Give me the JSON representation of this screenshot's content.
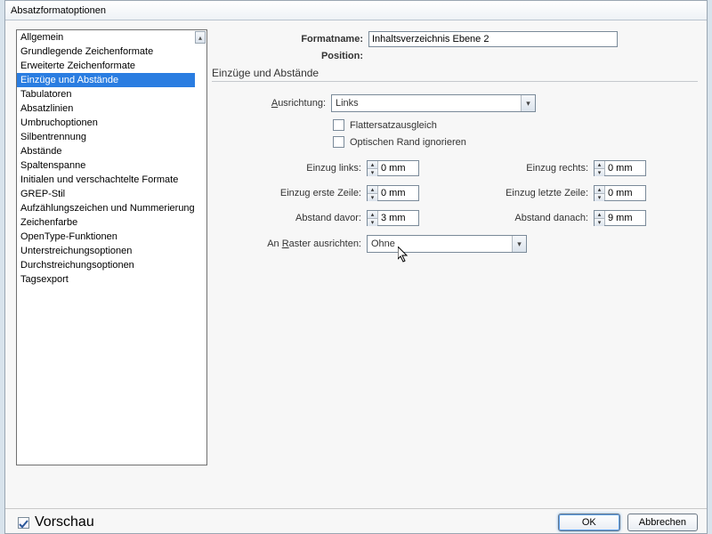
{
  "window": {
    "title": "Absatzformatoptionen"
  },
  "sidebar": {
    "items": [
      {
        "label": "Allgemein"
      },
      {
        "label": "Grundlegende Zeichenformate"
      },
      {
        "label": "Erweiterte Zeichenformate"
      },
      {
        "label": "Einzüge und Abstände"
      },
      {
        "label": "Tabulatoren"
      },
      {
        "label": "Absatzlinien"
      },
      {
        "label": "Umbruchoptionen"
      },
      {
        "label": "Silbentrennung"
      },
      {
        "label": "Abstände"
      },
      {
        "label": "Spaltenspanne"
      },
      {
        "label": "Initialen und verschachtelte Formate"
      },
      {
        "label": "GREP-Stil"
      },
      {
        "label": "Aufzählungszeichen und Nummerierung"
      },
      {
        "label": "Zeichenfarbe"
      },
      {
        "label": "OpenType-Funktionen"
      },
      {
        "label": "Unterstreichungsoptionen"
      },
      {
        "label": "Durchstreichungsoptionen"
      },
      {
        "label": "Tagsexport"
      }
    ],
    "selected_index": 3
  },
  "header": {
    "formatname_label": "Formatname:",
    "formatname_value": "Inhaltsverzeichnis Ebene 2",
    "position_label": "Position:"
  },
  "section": {
    "title": "Einzüge und Abstände"
  },
  "fields": {
    "ausrichtung_label": "usrichtung:",
    "ausrichtung_value": "Links",
    "flattersatz": "Flattersatzausgleich",
    "opt_rand": "Optischen Rand ignorieren",
    "einzug_links_label": "Einzug links:",
    "einzug_links_value": "0 mm",
    "einzug_rechts_label": "Einzug rechts:",
    "einzug_rechts_value": "0 mm",
    "einzug_erste_label": "Einzug erste Zeile:",
    "einzug_erste_value": "0 mm",
    "einzug_letzte_label": "Einzug letzte Zeile:",
    "einzug_letzte_value": "0 mm",
    "abstand_davor_label": "Abstand davor:",
    "abstand_davor_value": "3 mm",
    "abstand_danach_label": "Abstand danach:",
    "abstand_danach_value": "9 mm",
    "raster_label_pre": "An ",
    "raster_label_post": "aster ausrichten:",
    "raster_value": "Ohne"
  },
  "footer": {
    "vorschau": "Vorschau",
    "ok": "OK",
    "cancel": "Abbrechen"
  }
}
